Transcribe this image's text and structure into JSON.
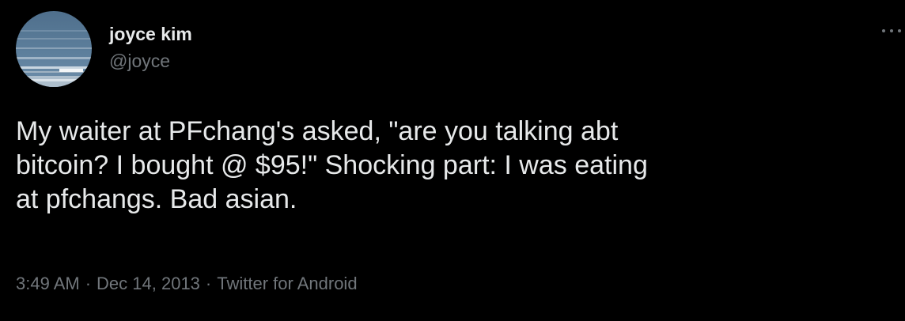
{
  "author": {
    "display_name": "joyce kim",
    "handle": "@joyce",
    "avatar_icon": "ocean-waves-avatar"
  },
  "more_menu_icon": "more-horizontal-icon",
  "tweet": {
    "text": "My waiter at PFchang's asked, \"are you talking abt\nbitcoin? I bought @ $95!\" Shocking part: I was eating\nat pfchangs. Bad asian."
  },
  "meta": {
    "time": "3:49 AM",
    "separator": "·",
    "date": "Dec 14, 2013",
    "source": "Twitter for Android"
  },
  "colors": {
    "background": "#000000",
    "primary_text": "#e7e9ea",
    "secondary_text": "#71767b"
  }
}
